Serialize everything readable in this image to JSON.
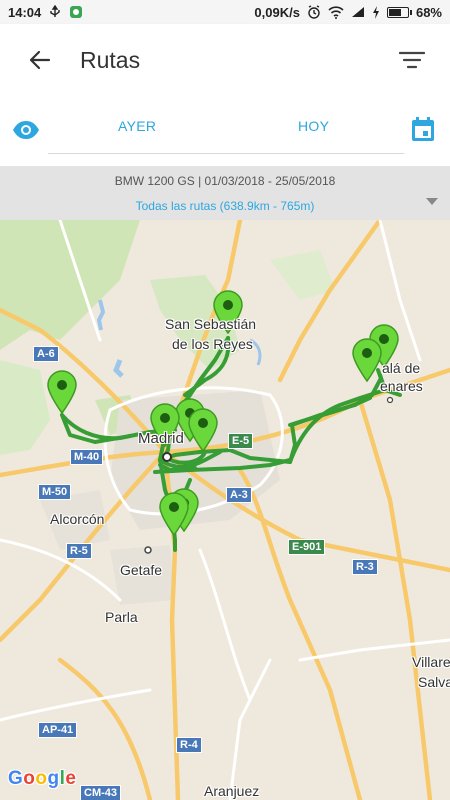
{
  "status_bar": {
    "time": "14:04",
    "network_speed": "0,09K/s",
    "battery_percent": "68%",
    "battery_level": 0.68
  },
  "app_bar": {
    "title": "Rutas",
    "back_icon": "arrow-back-icon",
    "filter_icon": "filter-icon"
  },
  "tabs": {
    "visibility_icon": "eye-icon",
    "items": [
      "AYER",
      "HOY"
    ],
    "calendar_icon": "calendar-icon"
  },
  "summary": {
    "vehicle_period": "BMW 1200 GS | 01/03/2018 - 25/05/2018",
    "routes_total": "Todas las rutas (638.9km - 765m)"
  },
  "map": {
    "route_color": "#2e9a2e",
    "pin_color": "#6ad83a",
    "labels": {
      "san_sebastian_1": "San Sebastián",
      "san_sebastian_2": "de los Reyes",
      "alcala_1": "alá de",
      "alcala_2": "enares",
      "madrid": "Madrid",
      "alcorcon": "Alcorcón",
      "getafe": "Getafe",
      "parla": "Parla",
      "villarejo": "Villare",
      "salvan": "Salva",
      "aranjuez": "Aranjuez"
    },
    "road_badges": [
      "A-6",
      "M-40",
      "M-50",
      "R-5",
      "E-5",
      "A-3",
      "E-901",
      "R-3",
      "AP-41",
      "R-4",
      "CM-43"
    ],
    "attribution": "Google"
  }
}
